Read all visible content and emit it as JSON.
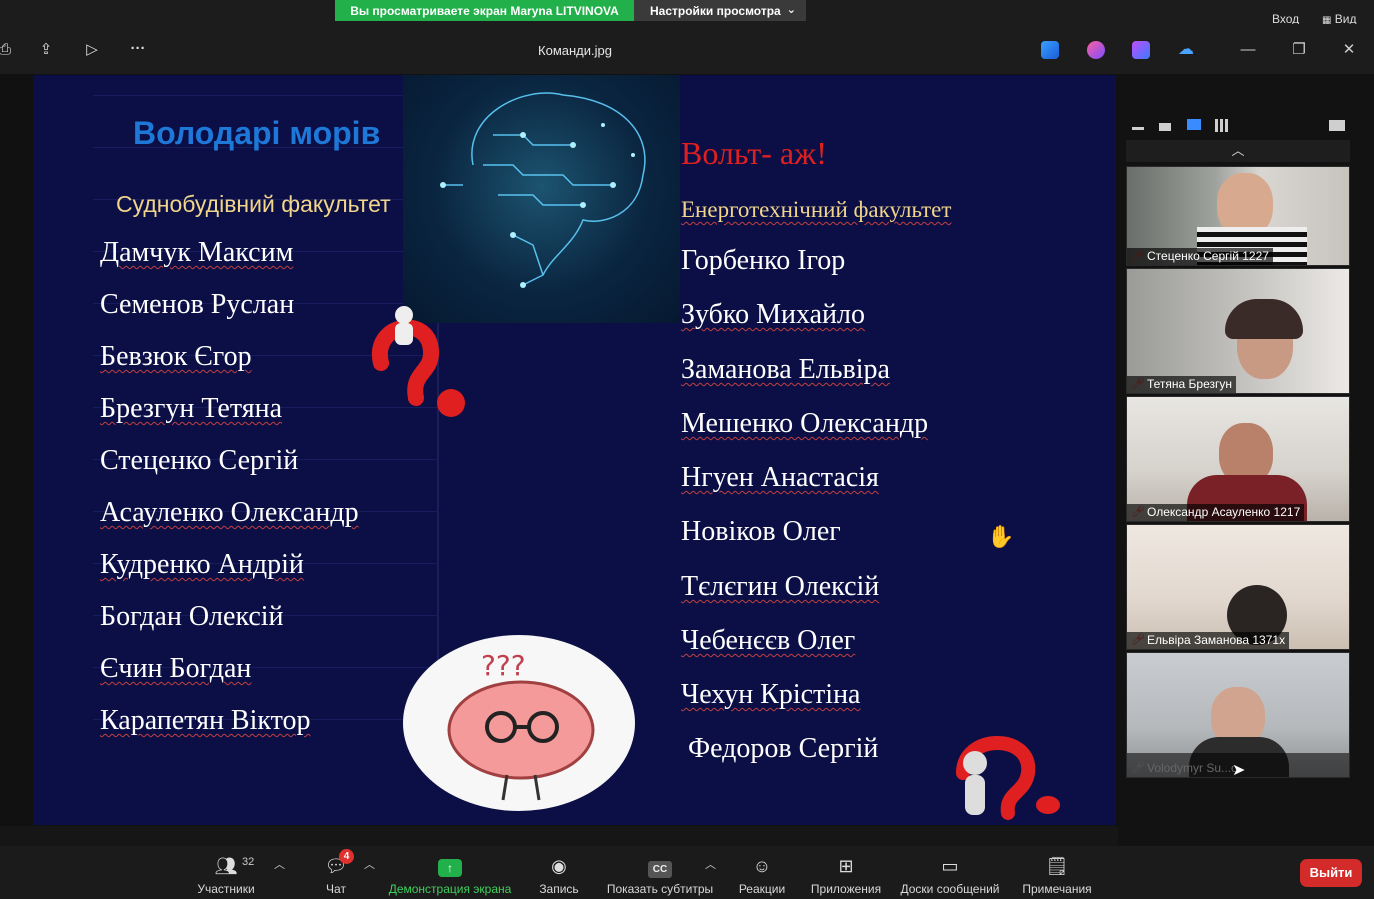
{
  "banner": {
    "sharing_text": "Вы просматриваете экран Maryna LITVINOVA",
    "view_settings": "Настройки просмотра",
    "signin": "Вход",
    "view": "Вид"
  },
  "toolbar": {
    "document_title": "Команди.jpg"
  },
  "slide": {
    "left_team": "Володарі морів",
    "left_faculty": "Суднобудівний  факультет",
    "left_names": [
      "Дамчук Максим",
      "Семенов Руслан",
      "Бевзюк Єгор",
      "Брезгун Тетяна",
      "Стеценко Сергій",
      "Асауленко Олександр",
      "Кудренко Андрій",
      "Богдан Олексій",
      "Єчин Богдан",
      "Карапетян Віктор"
    ],
    "right_team": "Вольт- аж!",
    "right_faculty": "Енерготехнічний факультет",
    "right_names": [
      "Горбенко  Ігор",
      "Зубко Михайло",
      "Заманова  Ельвіра",
      "Мешенко Олександр",
      "Нгуен Анастасія",
      "Новіков Олег",
      "Тєлєгин Олексій",
      "Чебенєєв Олег",
      "Чехун Крістіна",
      " Федоров Сергій"
    ]
  },
  "participants_panel": {
    "tiles": [
      {
        "name": "Стеценко Сергій 1227",
        "muted": true
      },
      {
        "name": "Тетяна Брезгун",
        "muted": true
      },
      {
        "name": "Олександр  Асауленко 1217",
        "muted": true
      },
      {
        "name": "Ельвіра Заманова 1371х",
        "muted": true
      },
      {
        "name": "Volodymyr Su...o",
        "muted": true
      }
    ]
  },
  "bottom_bar": {
    "participants_label": "Участники",
    "participants_count": "32",
    "chat_label": "Чат",
    "chat_badge": "4",
    "share_label": "Демонстрация экрана",
    "record_label": "Запись",
    "captions_label": "Показать субтитры",
    "reactions_label": "Реакции",
    "apps_label": "Приложения",
    "whiteboards_label": "Доски сообщений",
    "notes_label": "Примечания",
    "leave_label": "Выйти"
  },
  "colors": {
    "share_green": "#22b04a",
    "leave_red": "#d32a2a",
    "slide_bg": "#0c0f45",
    "left_title": "#1e78d8",
    "right_title": "#e02020",
    "faculty": "#f0d58a"
  }
}
